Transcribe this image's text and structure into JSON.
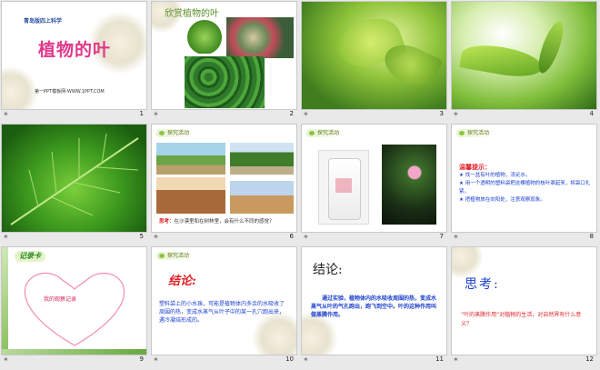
{
  "slides": [
    {
      "number": "1",
      "publisher": "青岛版四上科学",
      "title": "植物的叶",
      "footer": "第一PPT模板网-WWW.1PPT.COM"
    },
    {
      "number": "2",
      "title": "欣赏植物的叶"
    },
    {
      "number": "3"
    },
    {
      "number": "4"
    },
    {
      "number": "5"
    },
    {
      "number": "6",
      "tag": "探究活动",
      "caption_label": "思考：",
      "caption_text": "在沙漠里和在树林里，会有什么不同的感觉？"
    },
    {
      "number": "7",
      "tag": "探究活动"
    },
    {
      "number": "8",
      "tag": "探究活动",
      "tip_title": "温馨提示：",
      "tips": [
        "找一盆有叶的植物，浇足水。",
        "用一个透明的塑料袋把这棵植物的枝叶罩起来，将袋口扎紧。",
        "把植物放在向阳处，注意观察现象。"
      ]
    },
    {
      "number": "9",
      "logo": "记录卡",
      "record_label": "我的观察记录"
    },
    {
      "number": "10",
      "tag": "探究活动",
      "heading": "结论:",
      "body": "塑料袋上的小水珠，可能是植物体内多余的水吸收了周围的热，变成水蒸气从叶子中的某一孔穴跑出来，遇冷凝结形成的。"
    },
    {
      "number": "11",
      "heading": "结论:",
      "body": "通过实验，植物体内的水吸收周围的热，变成水蒸气从叶的气孔跑出，跑飞到空中。叶的这种作用叫做蒸腾作用。"
    },
    {
      "number": "12",
      "heading": "思考:",
      "body": "“叶的蒸腾作用”对植物的生活，对自然界有什么意义？"
    }
  ],
  "theme": {
    "tag_green": "#8cc541",
    "title_pink": "#e0388a",
    "heading_red": "#e0252b",
    "blue": "#1a3fcf"
  }
}
